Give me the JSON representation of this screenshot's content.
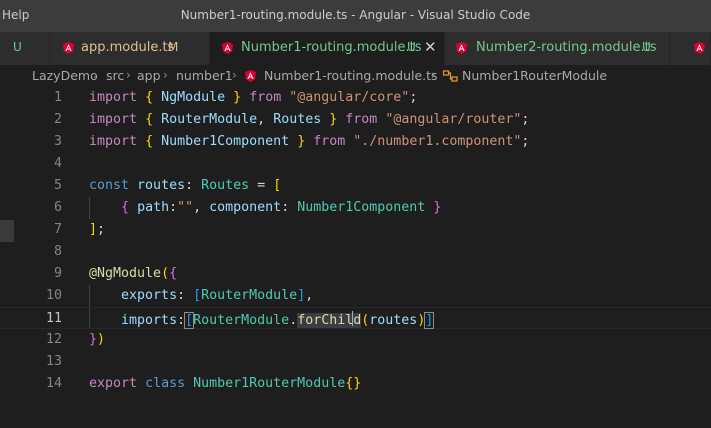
{
  "window": {
    "menu_help": "Help",
    "title": "Number1-routing.module.ts - Angular - Visual Studio Code"
  },
  "colors": {
    "modified": "#e2c08d",
    "untracked": "#73c991",
    "angular": "#dd0031"
  },
  "tabs": [
    {
      "label": "",
      "status": "U"
    },
    {
      "label": "app.module.ts",
      "status": "M",
      "icon": "angular-icon"
    },
    {
      "label": "Number1-routing.module.ts",
      "status": "U",
      "icon": "angular-icon",
      "active": true
    },
    {
      "label": "Number2-routing.module.ts",
      "status": "U",
      "icon": "angular-icon"
    },
    {
      "label": "",
      "icon": "angular-icon"
    }
  ],
  "breadcrumb": [
    "LazyDemo",
    "src",
    "app",
    "number1",
    "Number1-routing.module.ts",
    "Number1RouterModule"
  ],
  "gutter_lines": [
    "1",
    "2",
    "3",
    "4",
    "5",
    "6",
    "7",
    "8",
    "9",
    "10",
    "11",
    "12",
    "13",
    "14"
  ],
  "current_line": 11,
  "code": {
    "import": "import",
    "from": "from",
    "const": "const",
    "export": "export",
    "class": "class",
    "ngmodule": "NgModule",
    "routermodule": "RouterModule",
    "routes_type": "Routes",
    "number1component": "Number1Component",
    "routes_var": "routes",
    "str_core": "\"@angular/core\"",
    "str_router": "\"@angular/router\"",
    "str_comp": "\"./number1.component\"",
    "str_empty": "\"\"",
    "path": "path",
    "component": "component",
    "exports": "exports",
    "imports": "imports",
    "decorator": "@NgModule",
    "forchild_a": "forChil",
    "forchild_b": "d",
    "router_class": "Number1RouterModule"
  }
}
